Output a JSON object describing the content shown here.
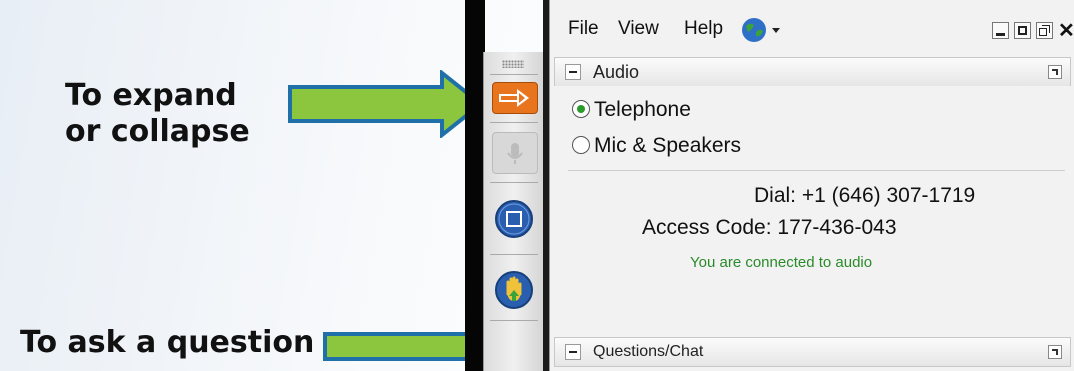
{
  "annotations": {
    "expand_caption": "To expand\nor collapse",
    "question_caption": "To ask a question"
  },
  "menu": {
    "file": "File",
    "view": "View",
    "help": "Help"
  },
  "audio_panel": {
    "title": "Audio",
    "options": [
      {
        "label": "Telephone",
        "selected": true
      },
      {
        "label": "Mic & Speakers",
        "selected": false
      }
    ],
    "dial": "Dial: +1 (646) 307-1719",
    "access_code": "Access Code: 177-436-043",
    "status": "You are connected to audio"
  },
  "questions_panel": {
    "title": "Questions/Chat"
  },
  "icons": {
    "globe": "globe-icon",
    "expand": "arrow-right-icon",
    "mic": "microphone-icon",
    "screen": "screen-icon",
    "hand": "raise-hand-icon"
  },
  "colors": {
    "arrow_fill": "#8cc63f",
    "arrow_stroke": "#1f6fa8",
    "status_green": "#2a8a2a",
    "expand_button": "#e8741e",
    "round_button": "#2a5fb0"
  }
}
